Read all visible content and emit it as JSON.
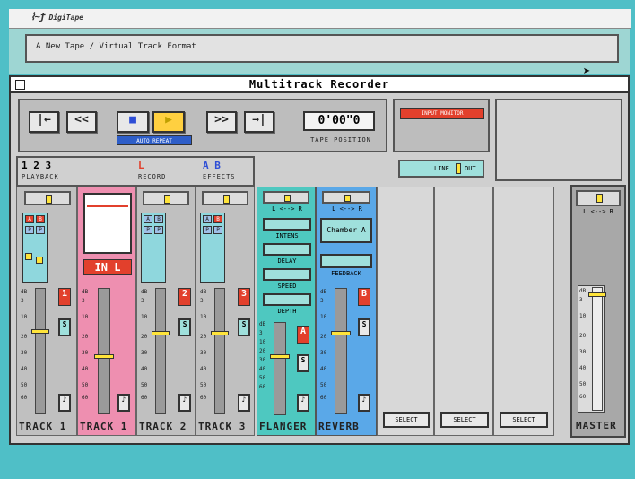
{
  "menubar": {
    "logo": "DigiTape"
  },
  "tape": {
    "format": "A New Tape / Virtual Track Format"
  },
  "window": {
    "title": "Multitrack Recorder"
  },
  "transport": {
    "auto_repeat": "AUTO REPEAT",
    "time": "0'00\"0",
    "tape_position": "TAPE POSITION",
    "rew_to_start": "|←",
    "rewind": "<<",
    "stop": "■",
    "play": "▶",
    "ffwd": ">>",
    "ffwd_end": "→|"
  },
  "input_monitor": "INPUT MONITOR",
  "line_out": {
    "left": "LINE",
    "right": "OUT"
  },
  "header": {
    "playback_num": "1 2 3",
    "playback": "PLAYBACK",
    "record_num": "L",
    "record": "RECORD",
    "effects_num": "A B",
    "effects": "EFFECTS"
  },
  "tracks": [
    {
      "label": "TRACK 1",
      "badge": "1"
    },
    {
      "label": "TRACK 1",
      "input": "IN L"
    },
    {
      "label": "TRACK 2",
      "badge": "2"
    },
    {
      "label": "TRACK 3",
      "badge": "3"
    }
  ],
  "flanger": {
    "label": "FLANGER",
    "pan": "L <--> R",
    "params": [
      "INTENS",
      "DELAY",
      "SPEED",
      "DEPTH"
    ],
    "badge": "A"
  },
  "reverb": {
    "label": "REVERB",
    "pan": "L <--> R",
    "preset": "Chamber A",
    "feedback": "FEEDBACK",
    "badge": "B"
  },
  "select": {
    "label": "SELECT"
  },
  "master": {
    "label": "MASTER",
    "pan": "L <--> R"
  },
  "scale": [
    "dB",
    "3",
    "10",
    "20",
    "30",
    "40",
    "50",
    "60"
  ],
  "routing": {
    "r": "R",
    "a": "A",
    "b": "B",
    "p": "P"
  },
  "solo": "S",
  "colors": {
    "accent_red": "#e2402c",
    "teal": "#4fbfc7",
    "pink": "#ee8fb0",
    "blue": "#5aa8e8",
    "fx_teal": "#4ec8c0"
  }
}
